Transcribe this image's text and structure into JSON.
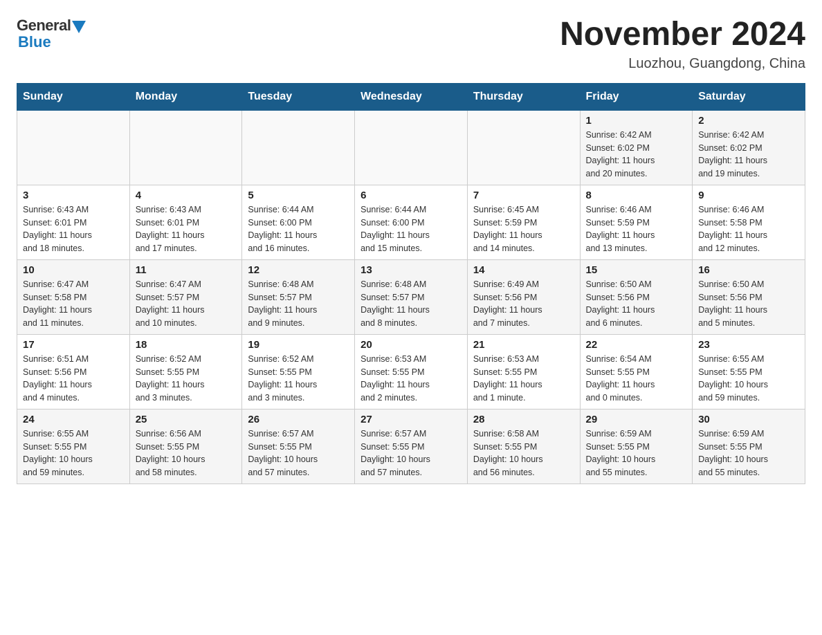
{
  "header": {
    "logo_general": "General",
    "logo_blue": "Blue",
    "month_title": "November 2024",
    "location": "Luozhou, Guangdong, China"
  },
  "days_of_week": [
    "Sunday",
    "Monday",
    "Tuesday",
    "Wednesday",
    "Thursday",
    "Friday",
    "Saturday"
  ],
  "weeks": [
    [
      {
        "day": "",
        "info": ""
      },
      {
        "day": "",
        "info": ""
      },
      {
        "day": "",
        "info": ""
      },
      {
        "day": "",
        "info": ""
      },
      {
        "day": "",
        "info": ""
      },
      {
        "day": "1",
        "info": "Sunrise: 6:42 AM\nSunset: 6:02 PM\nDaylight: 11 hours\nand 20 minutes."
      },
      {
        "day": "2",
        "info": "Sunrise: 6:42 AM\nSunset: 6:02 PM\nDaylight: 11 hours\nand 19 minutes."
      }
    ],
    [
      {
        "day": "3",
        "info": "Sunrise: 6:43 AM\nSunset: 6:01 PM\nDaylight: 11 hours\nand 18 minutes."
      },
      {
        "day": "4",
        "info": "Sunrise: 6:43 AM\nSunset: 6:01 PM\nDaylight: 11 hours\nand 17 minutes."
      },
      {
        "day": "5",
        "info": "Sunrise: 6:44 AM\nSunset: 6:00 PM\nDaylight: 11 hours\nand 16 minutes."
      },
      {
        "day": "6",
        "info": "Sunrise: 6:44 AM\nSunset: 6:00 PM\nDaylight: 11 hours\nand 15 minutes."
      },
      {
        "day": "7",
        "info": "Sunrise: 6:45 AM\nSunset: 5:59 PM\nDaylight: 11 hours\nand 14 minutes."
      },
      {
        "day": "8",
        "info": "Sunrise: 6:46 AM\nSunset: 5:59 PM\nDaylight: 11 hours\nand 13 minutes."
      },
      {
        "day": "9",
        "info": "Sunrise: 6:46 AM\nSunset: 5:58 PM\nDaylight: 11 hours\nand 12 minutes."
      }
    ],
    [
      {
        "day": "10",
        "info": "Sunrise: 6:47 AM\nSunset: 5:58 PM\nDaylight: 11 hours\nand 11 minutes."
      },
      {
        "day": "11",
        "info": "Sunrise: 6:47 AM\nSunset: 5:57 PM\nDaylight: 11 hours\nand 10 minutes."
      },
      {
        "day": "12",
        "info": "Sunrise: 6:48 AM\nSunset: 5:57 PM\nDaylight: 11 hours\nand 9 minutes."
      },
      {
        "day": "13",
        "info": "Sunrise: 6:48 AM\nSunset: 5:57 PM\nDaylight: 11 hours\nand 8 minutes."
      },
      {
        "day": "14",
        "info": "Sunrise: 6:49 AM\nSunset: 5:56 PM\nDaylight: 11 hours\nand 7 minutes."
      },
      {
        "day": "15",
        "info": "Sunrise: 6:50 AM\nSunset: 5:56 PM\nDaylight: 11 hours\nand 6 minutes."
      },
      {
        "day": "16",
        "info": "Sunrise: 6:50 AM\nSunset: 5:56 PM\nDaylight: 11 hours\nand 5 minutes."
      }
    ],
    [
      {
        "day": "17",
        "info": "Sunrise: 6:51 AM\nSunset: 5:56 PM\nDaylight: 11 hours\nand 4 minutes."
      },
      {
        "day": "18",
        "info": "Sunrise: 6:52 AM\nSunset: 5:55 PM\nDaylight: 11 hours\nand 3 minutes."
      },
      {
        "day": "19",
        "info": "Sunrise: 6:52 AM\nSunset: 5:55 PM\nDaylight: 11 hours\nand 3 minutes."
      },
      {
        "day": "20",
        "info": "Sunrise: 6:53 AM\nSunset: 5:55 PM\nDaylight: 11 hours\nand 2 minutes."
      },
      {
        "day": "21",
        "info": "Sunrise: 6:53 AM\nSunset: 5:55 PM\nDaylight: 11 hours\nand 1 minute."
      },
      {
        "day": "22",
        "info": "Sunrise: 6:54 AM\nSunset: 5:55 PM\nDaylight: 11 hours\nand 0 minutes."
      },
      {
        "day": "23",
        "info": "Sunrise: 6:55 AM\nSunset: 5:55 PM\nDaylight: 10 hours\nand 59 minutes."
      }
    ],
    [
      {
        "day": "24",
        "info": "Sunrise: 6:55 AM\nSunset: 5:55 PM\nDaylight: 10 hours\nand 59 minutes."
      },
      {
        "day": "25",
        "info": "Sunrise: 6:56 AM\nSunset: 5:55 PM\nDaylight: 10 hours\nand 58 minutes."
      },
      {
        "day": "26",
        "info": "Sunrise: 6:57 AM\nSunset: 5:55 PM\nDaylight: 10 hours\nand 57 minutes."
      },
      {
        "day": "27",
        "info": "Sunrise: 6:57 AM\nSunset: 5:55 PM\nDaylight: 10 hours\nand 57 minutes."
      },
      {
        "day": "28",
        "info": "Sunrise: 6:58 AM\nSunset: 5:55 PM\nDaylight: 10 hours\nand 56 minutes."
      },
      {
        "day": "29",
        "info": "Sunrise: 6:59 AM\nSunset: 5:55 PM\nDaylight: 10 hours\nand 55 minutes."
      },
      {
        "day": "30",
        "info": "Sunrise: 6:59 AM\nSunset: 5:55 PM\nDaylight: 10 hours\nand 55 minutes."
      }
    ]
  ]
}
